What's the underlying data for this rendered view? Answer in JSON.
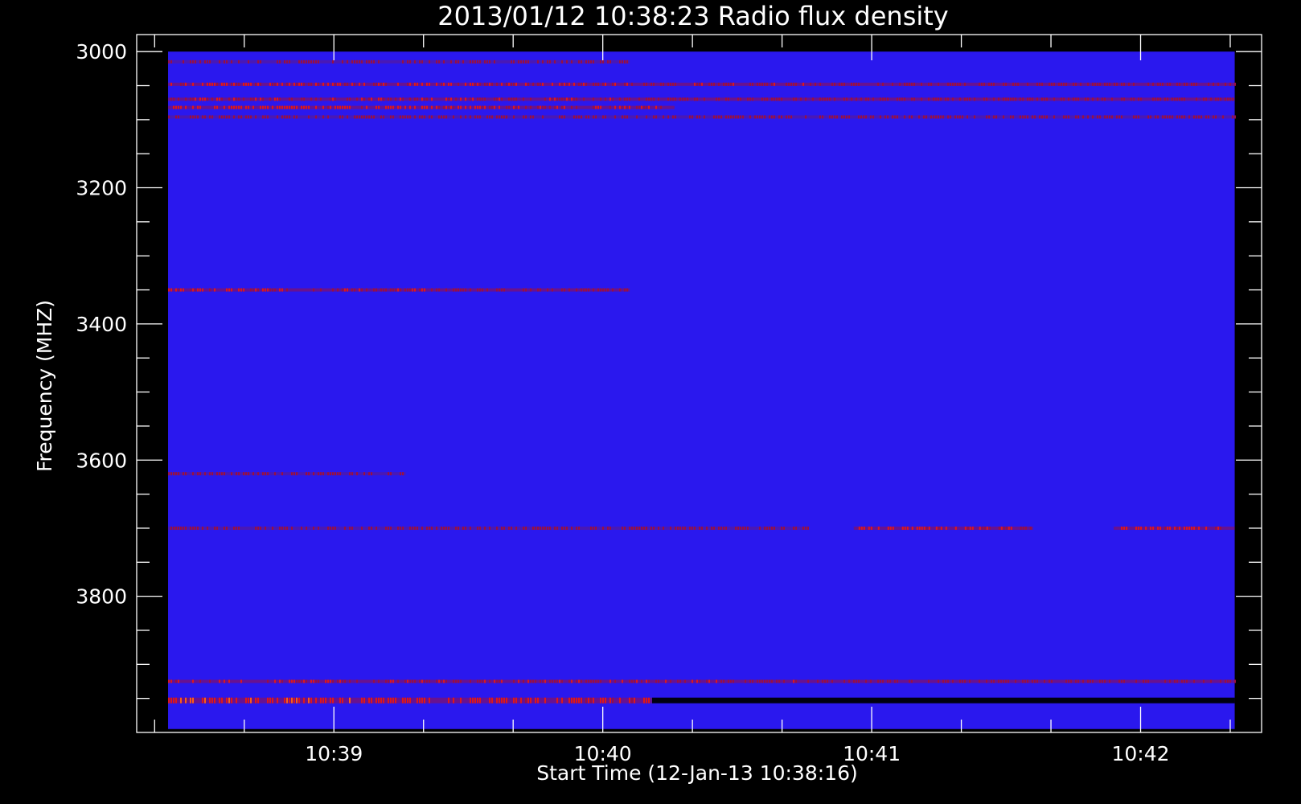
{
  "chart_data": {
    "type": "heatmap",
    "title": "2013/01/12 10:38:23 Radio flux density",
    "xlabel": "Start Time (12-Jan-13 10:38:16)",
    "ylabel": "Frequency (MHZ)",
    "x_unit": "seconds after 10:38:16",
    "xlim": [
      0,
      251
    ],
    "ylim": [
      4000,
      2975
    ],
    "y_inverted": true,
    "data_extent": {
      "x": [
        7,
        245
      ],
      "y": [
        3000,
        3995
      ]
    },
    "x_major_ticks": [
      {
        "label": "10:39",
        "value": 44
      },
      {
        "label": "10:40",
        "value": 104
      },
      {
        "label": "10:41",
        "value": 164
      },
      {
        "label": "10:42",
        "value": 224
      }
    ],
    "y_major_ticks": [
      {
        "label": "3000",
        "value": 3000
      },
      {
        "label": "3200",
        "value": 3200
      },
      {
        "label": "3400",
        "value": 3400
      },
      {
        "label": "3600",
        "value": 3600
      },
      {
        "label": "3800",
        "value": 3800
      }
    ],
    "background_color": "#2a18ee",
    "colormap": [
      "#000000",
      "#1010d0",
      "#2a18ee",
      "#a01030",
      "#e01010",
      "#ffa000",
      "#ffff80"
    ],
    "features": [
      {
        "freq": 3015,
        "t_start": 7,
        "t_end": 110,
        "intensity": 0.45
      },
      {
        "freq": 3048,
        "t_start": 7,
        "t_end": 245,
        "intensity": 0.6
      },
      {
        "freq": 3070,
        "t_start": 7,
        "t_end": 245,
        "intensity": 0.55
      },
      {
        "freq": 3082,
        "t_start": 7,
        "t_end": 120,
        "intensity": 0.8
      },
      {
        "freq": 3096,
        "t_start": 7,
        "t_end": 245,
        "intensity": 0.35
      },
      {
        "freq": 3350,
        "t_start": 7,
        "t_end": 110,
        "intensity": 0.6
      },
      {
        "freq": 3620,
        "t_start": 7,
        "t_end": 60,
        "intensity": 0.3
      },
      {
        "freq": 3700,
        "t_start": 7,
        "t_end": 150,
        "intensity": 0.35
      },
      {
        "freq": 3700,
        "t_start": 160,
        "t_end": 200,
        "intensity": 0.75
      },
      {
        "freq": 3700,
        "t_start": 218,
        "t_end": 245,
        "intensity": 0.8
      },
      {
        "freq": 3925,
        "t_start": 7,
        "t_end": 245,
        "intensity": 0.6
      },
      {
        "freq": 3953,
        "t_start": 7,
        "t_end": 115,
        "intensity": 0.95
      },
      {
        "freq": 3953,
        "t_start": 115,
        "t_end": 245,
        "intensity": -1
      }
    ]
  }
}
